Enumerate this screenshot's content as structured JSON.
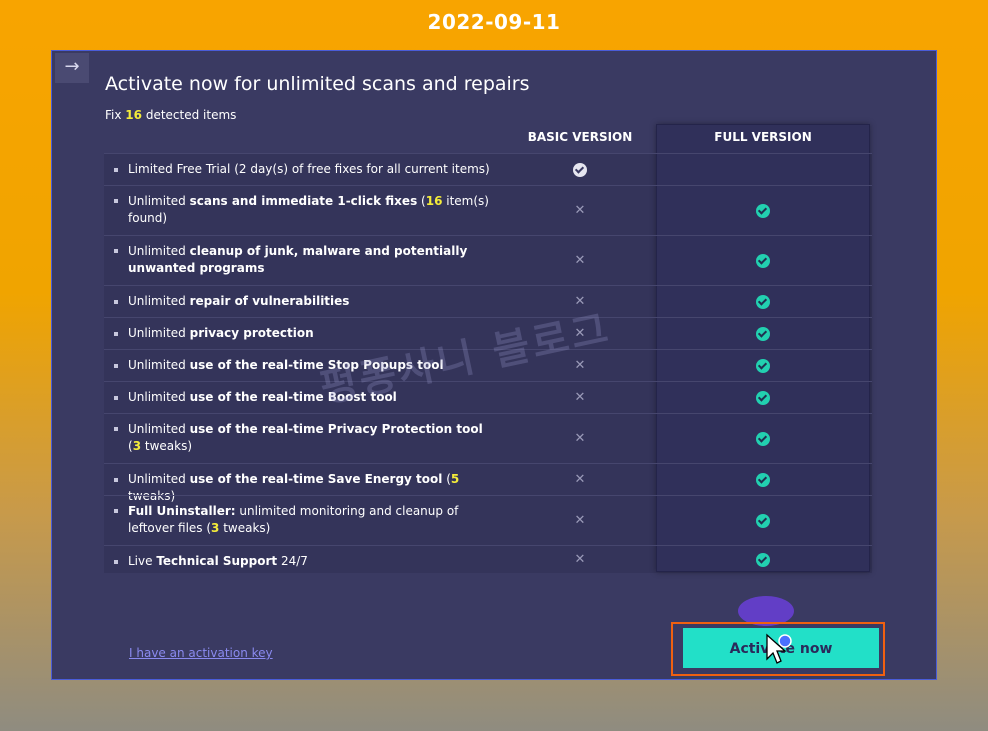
{
  "overlay_date": "2022-09-11",
  "header": {
    "title": "Activate now for unlimited scans and repairs",
    "fix_prefix": "Fix",
    "fix_count": "16",
    "fix_suffix": "detected items"
  },
  "columns": {
    "basic": "BASIC VERSION",
    "full": "FULL VERSION"
  },
  "rows": [
    {
      "parts": [
        [
          "Limited Free Trial",
          false
        ],
        [
          " (2 day(s) of free fixes for all current items)",
          false
        ]
      ],
      "basic": "check",
      "full": "none"
    },
    {
      "parts": [
        [
          "Unlimited ",
          false
        ],
        [
          "scans and immediate 1-click fixes",
          true
        ],
        [
          " (",
          false
        ],
        [
          "16",
          "hl"
        ],
        [
          " item(s) found)",
          false
        ]
      ],
      "basic": "x",
      "full": "check"
    },
    {
      "parts": [
        [
          "Unlimited ",
          false
        ],
        [
          "cleanup of junk, malware and potentially unwanted programs",
          true
        ]
      ],
      "basic": "x",
      "full": "check"
    },
    {
      "parts": [
        [
          "Unlimited ",
          false
        ],
        [
          "repair of vulnerabilities",
          true
        ]
      ],
      "basic": "x",
      "full": "check"
    },
    {
      "parts": [
        [
          "Unlimited ",
          false
        ],
        [
          "privacy protection",
          true
        ]
      ],
      "basic": "x",
      "full": "check"
    },
    {
      "parts": [
        [
          "Unlimited ",
          false
        ],
        [
          "use of the real-time Stop Popups tool",
          true
        ]
      ],
      "basic": "x",
      "full": "check"
    },
    {
      "parts": [
        [
          "Unlimited ",
          false
        ],
        [
          "use of the real-time Boost tool",
          true
        ]
      ],
      "basic": "x",
      "full": "check"
    },
    {
      "parts": [
        [
          "Unlimited ",
          false
        ],
        [
          "use of the real-time Privacy Protection tool",
          true
        ],
        [
          " (",
          false
        ],
        [
          "3",
          "hl"
        ],
        [
          " tweaks)",
          false
        ]
      ],
      "basic": "x",
      "full": "check"
    },
    {
      "parts": [
        [
          "Unlimited ",
          false
        ],
        [
          "use of the real-time Save Energy tool",
          true
        ],
        [
          " (",
          false
        ],
        [
          "5",
          "hl"
        ],
        [
          " tweaks)",
          false
        ]
      ],
      "basic": "x",
      "full": "check"
    },
    {
      "parts": [
        [
          "Full Uninstaller:",
          true
        ],
        [
          " unlimited monitoring and cleanup of leftover files (",
          false
        ],
        [
          "3",
          "hl"
        ],
        [
          " tweaks)",
          false
        ]
      ],
      "basic": "x",
      "full": "check"
    },
    {
      "parts": [
        [
          "Live ",
          false
        ],
        [
          "Technical Support",
          true
        ],
        [
          " 24/7",
          false
        ]
      ],
      "basic": "x",
      "full": "check"
    }
  ],
  "footer": {
    "activation_link": "I have an activation key",
    "activate_button": "Activate now"
  },
  "watermark": "펑퐁사니 블로그",
  "icons": {
    "back": "arrow-right-icon",
    "check": "check-circle-icon",
    "x": "x-icon"
  },
  "colors": {
    "accent": "#22e0c8",
    "highlight": "#f4ec3a",
    "window_bg": "#3a3a62"
  }
}
